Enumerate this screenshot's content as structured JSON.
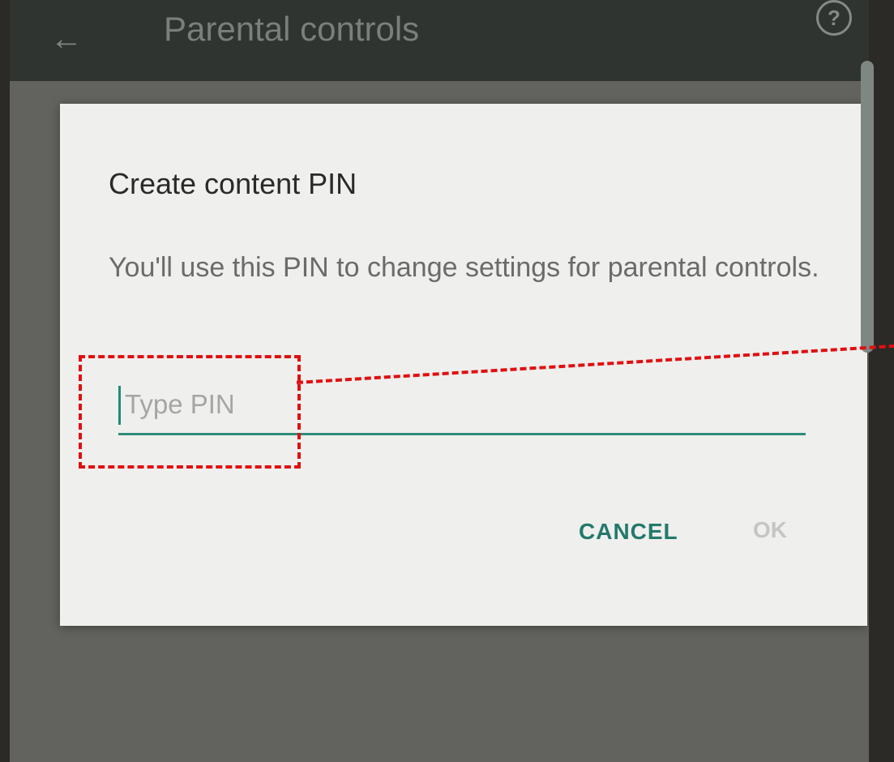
{
  "appbar": {
    "title": "Parental controls",
    "back_icon": "arrow-left-icon",
    "help_icon": "help-circle-icon",
    "help_glyph": "?"
  },
  "dialog": {
    "title": "Create content PIN",
    "message": "You'll use this PIN to change settings for parental controls.",
    "pin_placeholder": "Type PIN",
    "pin_value": "",
    "cancel_label": "CANCEL",
    "ok_label": "OK"
  },
  "colors": {
    "accent": "#23796c",
    "annotation": "#e01010",
    "dialog_bg": "#efefed"
  }
}
